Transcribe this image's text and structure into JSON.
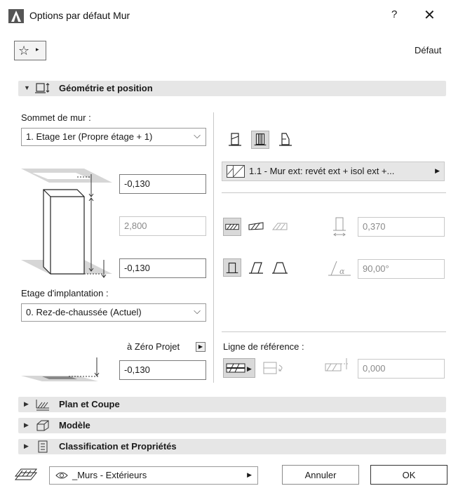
{
  "window": {
    "title": "Options par défaut Mur",
    "help": "?",
    "close": "✕"
  },
  "favorites": {
    "star": "☆",
    "arrow": "▸",
    "default_label": "Défaut"
  },
  "geometry": {
    "header": "Géométrie et position",
    "top_label": "Sommet de mur :",
    "top_value": "1. Etage 1er (Propre étage + 1)",
    "offset_top": "-0,130",
    "height": "2,800",
    "offset_bottom": "-0,130",
    "home_story_label": "Etage d'implantation :",
    "home_story_value": "0. Rez-de-chaussée (Actuel)",
    "project_zero_label": "à Zéro Projet",
    "project_zero_value": "-0,130",
    "material": "1.1 - Mur ext: revét ext + isol ext +...",
    "thickness": "0,370",
    "angle": "90,00°",
    "reference_line_label": "Ligne de référence :",
    "reference_offset": "0,000"
  },
  "sections": {
    "plan": "Plan et Coupe",
    "model": "Modèle",
    "classification": "Classification et Propriétés"
  },
  "footer": {
    "layer": "_Murs - Extérieurs",
    "cancel": "Annuler",
    "ok": "OK"
  }
}
